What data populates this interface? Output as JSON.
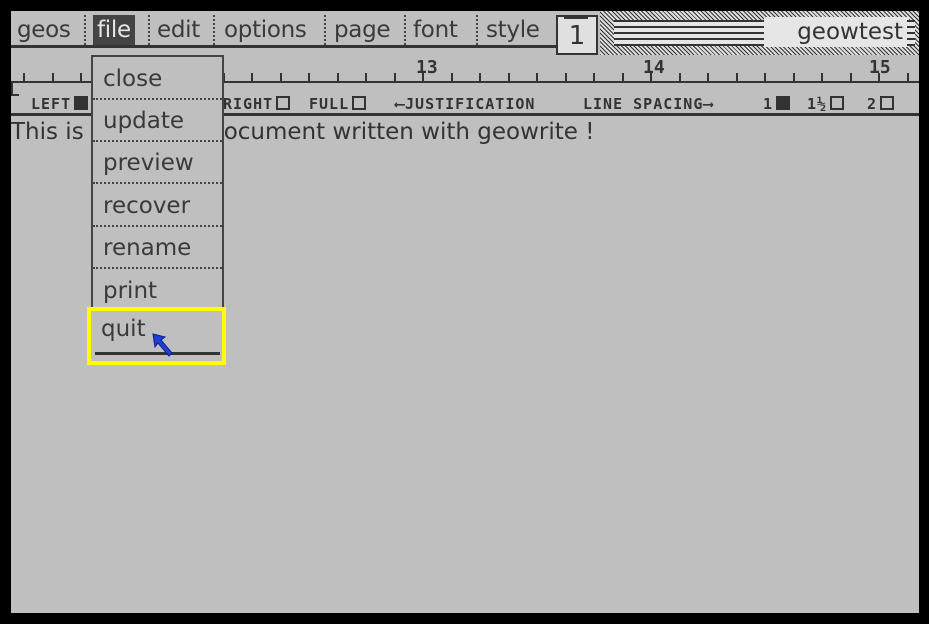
{
  "menubar": {
    "items": [
      {
        "label": "geos"
      },
      {
        "label": "file"
      },
      {
        "label": "edit"
      },
      {
        "label": "options"
      },
      {
        "label": "page"
      },
      {
        "label": "font"
      },
      {
        "label": "style"
      }
    ],
    "active": "file"
  },
  "page_indicator": "1",
  "window_title": "geowtest",
  "ruler": {
    "numbers": [
      "13",
      "14",
      "15"
    ],
    "left_label": "LEFT",
    "right_label": "RIGHT",
    "full_label": "FULL",
    "justification_label": "JUSTIFICATION",
    "line_spacing_label": "LINE SPACING",
    "spacing_1": "1",
    "spacing_1half": "1½",
    "spacing_2": "2"
  },
  "document": {
    "text_left": "This is",
    "text_right": "ocument written with geowrite !"
  },
  "file_menu": {
    "items": [
      {
        "label": "close"
      },
      {
        "label": "update"
      },
      {
        "label": "preview"
      },
      {
        "label": "recover"
      },
      {
        "label": "rename"
      },
      {
        "label": "print"
      },
      {
        "label": "quit"
      }
    ],
    "highlighted": "quit"
  },
  "colors": {
    "screen_bg": "#bfbfbf",
    "border": "#000000",
    "highlight": "#ffff00",
    "cursor": "#1f3fd6"
  },
  "icons": {
    "cursor": "arrow-pointer-icon",
    "ruler_marker": "left-margin-marker-icon"
  }
}
